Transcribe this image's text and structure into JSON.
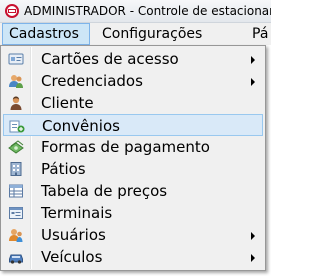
{
  "window": {
    "title": "ADMINISTRADOR - Controle de estacionament",
    "icon": "app-logo-icon"
  },
  "menubar": {
    "items": [
      {
        "label": "Cadastros",
        "active": true
      },
      {
        "label": "Configurações",
        "active": false
      },
      {
        "label": "Pá",
        "active": false
      }
    ]
  },
  "menu": {
    "items": [
      {
        "label": "Cartões de acesso",
        "icon": "card-icon",
        "submenu": true
      },
      {
        "label": "Credenciados",
        "icon": "users-icon",
        "submenu": true
      },
      {
        "label": "Cliente",
        "icon": "person-icon",
        "submenu": false
      },
      {
        "label": "Convênios",
        "icon": "agreement-icon",
        "submenu": false,
        "highlighted": true
      },
      {
        "label": "Formas de pagamento",
        "icon": "money-icon",
        "submenu": false
      },
      {
        "label": "Pátios",
        "icon": "building-icon",
        "submenu": false
      },
      {
        "label": "Tabela de preços",
        "icon": "table-icon",
        "submenu": false
      },
      {
        "label": "Terminais",
        "icon": "terminal-icon",
        "submenu": false
      },
      {
        "label": "Usuários",
        "icon": "user-group-icon",
        "submenu": true
      },
      {
        "label": "Veículos",
        "icon": "car-icon",
        "submenu": true
      }
    ]
  },
  "colors": {
    "highlight_bg": "#d9e9f8",
    "highlight_border": "#99c8ef",
    "menubar_active_bg": "#cde6f7",
    "menu_bg": "#f0f0f0"
  }
}
